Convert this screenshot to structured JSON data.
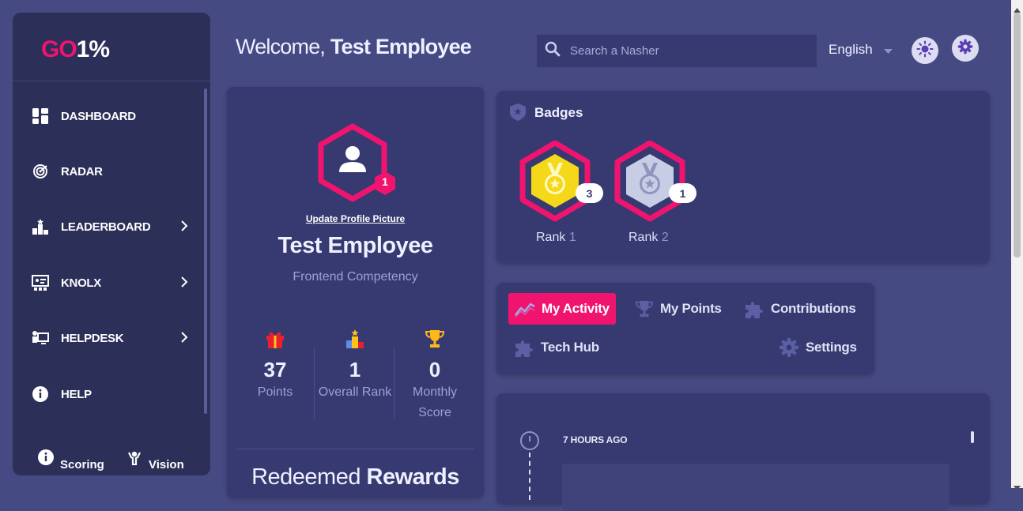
{
  "brand": {
    "part1": "GO",
    "part2": "1%"
  },
  "sidebar": {
    "items": [
      {
        "label": "DASHBOARD",
        "icon": "dashboard-icon"
      },
      {
        "label": "RADAR",
        "icon": "radar-icon"
      },
      {
        "label": "LEADERBOARD",
        "icon": "leaderboard-icon"
      },
      {
        "label": "KNOLX",
        "icon": "knolx-icon"
      },
      {
        "label": "HELPDESK",
        "icon": "helpdesk-icon"
      },
      {
        "label": "HELP",
        "icon": "info-icon"
      }
    ],
    "bottom": [
      {
        "label": "Scoring",
        "icon": "info-icon"
      },
      {
        "label": "Vision",
        "icon": "vision-icon"
      }
    ]
  },
  "header": {
    "welcome_prefix": "Welcome,",
    "user_name": "Test Employee",
    "search_placeholder": "Search a Nasher",
    "language": "English"
  },
  "profile": {
    "level_badge": "1",
    "update_link": "Update Profile Picture",
    "name": "Test Employee",
    "competency": "Frontend Competency",
    "stats": [
      {
        "value": "37",
        "label": "Points",
        "icon": "gift-icon"
      },
      {
        "value": "1",
        "label": "Overall Rank",
        "icon": "podium-icon"
      },
      {
        "value": "0",
        "label": "Monthly Score",
        "icon": "trophy-icon"
      }
    ],
    "redeemed_prefix": "Redeemed",
    "redeemed_bold": "Rewards"
  },
  "badges": {
    "title": "Badges",
    "items": [
      {
        "rank_word": "Rank",
        "rank_num": "1",
        "count": "3",
        "medal_color": "#f5d81a"
      },
      {
        "rank_word": "Rank",
        "rank_num": "2",
        "count": "1",
        "medal_color": "#c8cde6"
      }
    ]
  },
  "tabs": [
    {
      "label": "My Activity",
      "icon": "activity-icon",
      "active": true
    },
    {
      "label": "My Points",
      "icon": "trophy-icon"
    },
    {
      "label": "Contributions",
      "icon": "puzzle-icon"
    },
    {
      "label": "Tech Hub",
      "icon": "puzzle-icon"
    },
    {
      "label": "Settings",
      "icon": "gear-icon"
    }
  ],
  "activity": {
    "time": "7 HOURS AGO"
  },
  "colors": {
    "accent": "#f0146f",
    "background": "#464a83",
    "card": "#363a70",
    "sidebar": "#2c2f58"
  }
}
